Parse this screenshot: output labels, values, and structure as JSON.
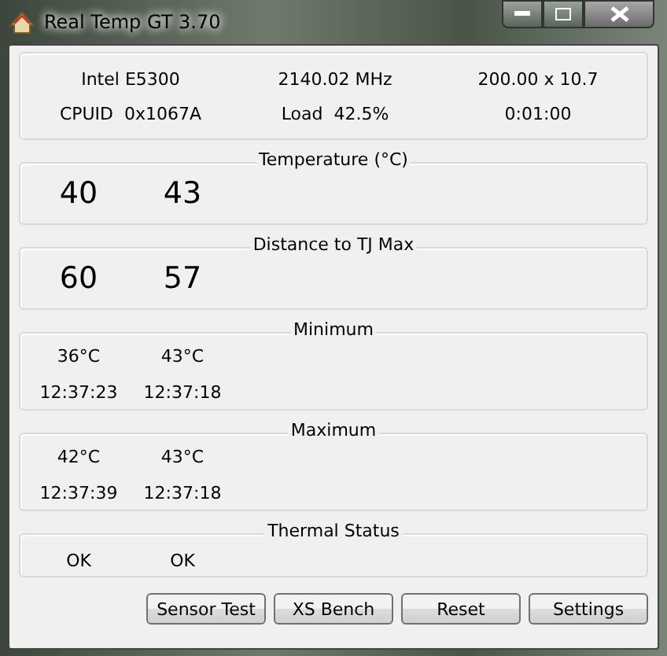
{
  "window": {
    "title": "Real Temp GT 3.70"
  },
  "info": [
    [
      "Intel E5300",
      "2140.02 MHz",
      "200.00 x 10.7"
    ],
    [
      "CPUID  0x1067A",
      "Load  42.5%",
      "0:01:00"
    ]
  ],
  "sections": [
    {
      "title": "Temperature (°C)",
      "kind": "big",
      "values": [
        "40",
        "43"
      ]
    },
    {
      "title": "Distance to TJ Max",
      "kind": "big",
      "values": [
        "60",
        "57"
      ]
    },
    {
      "title": "Minimum",
      "kind": "record",
      "entries": [
        {
          "temp": "36°C",
          "time": "12:37:23"
        },
        {
          "temp": "43°C",
          "time": "12:37:18"
        }
      ]
    },
    {
      "title": "Maximum",
      "kind": "record",
      "entries": [
        {
          "temp": "42°C",
          "time": "12:37:39"
        },
        {
          "temp": "43°C",
          "time": "12:37:18"
        }
      ]
    },
    {
      "title": "Thermal Status",
      "kind": "status",
      "values": [
        "OK",
        "OK"
      ]
    }
  ],
  "buttons": [
    "Sensor Test",
    "XS Bench",
    "Reset",
    "Settings"
  ]
}
